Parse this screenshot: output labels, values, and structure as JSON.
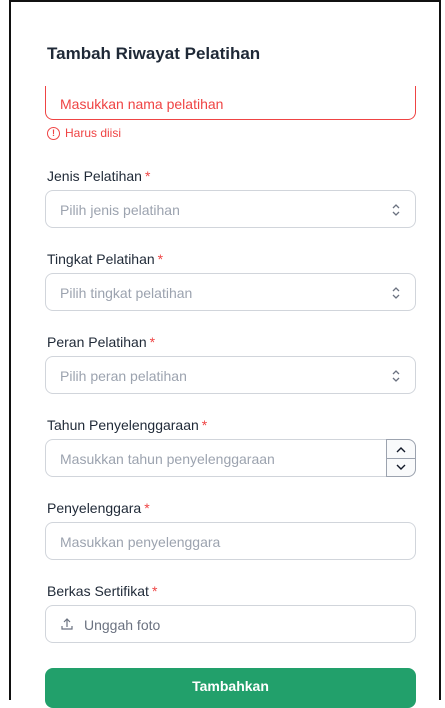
{
  "form": {
    "title": "Tambah Riwayat Pelatihan",
    "nama_pelatihan": {
      "placeholder": "Masukkan nama pelatihan",
      "error": "Harus diisi"
    },
    "required_mark": "*",
    "jenis": {
      "label": "Jenis Pelatihan",
      "placeholder": "Pilih jenis pelatihan"
    },
    "tingkat": {
      "label": "Tingkat Pelatihan",
      "placeholder": "Pilih tingkat pelatihan"
    },
    "peran": {
      "label": "Peran Pelatihan",
      "placeholder": "Pilih peran pelatihan"
    },
    "tahun": {
      "label": "Tahun Penyelenggaraan",
      "placeholder": "Masukkan tahun penyelenggaraan"
    },
    "penyelenggara": {
      "label": "Penyelenggara",
      "placeholder": "Masukkan penyelenggara"
    },
    "berkas": {
      "label": "Berkas Sertifikat",
      "upload_text": "Unggah foto"
    },
    "submit_label": "Tambahkan"
  },
  "colors": {
    "error": "#ef4444",
    "primary": "#22a06b",
    "border": "#d1d5db",
    "placeholder": "#9ca3af"
  },
  "icons": {
    "alert": "alert-circle-icon",
    "select": "chevron-up-down-icon",
    "upload": "upload-icon"
  }
}
